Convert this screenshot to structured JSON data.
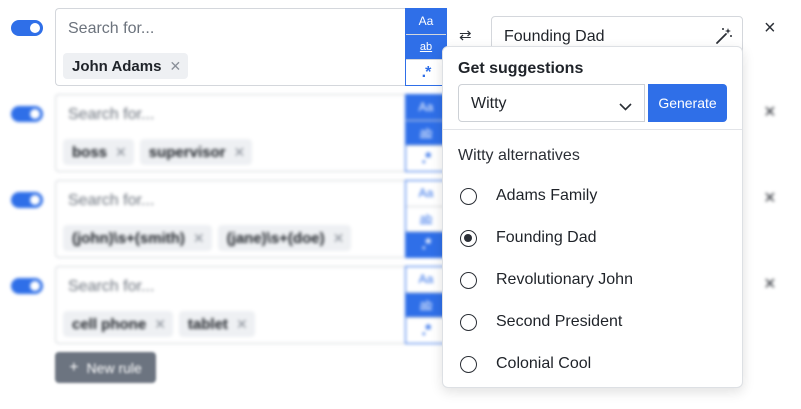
{
  "rules": [
    {
      "enabled": true,
      "placeholder": "Search for...",
      "terms": [
        "John Adams"
      ],
      "match_case": false,
      "whole_word": false,
      "regex": false
    },
    {
      "enabled": true,
      "placeholder": "Search for...",
      "terms": [
        "boss",
        "supervisor"
      ],
      "match_case": true,
      "whole_word": true,
      "regex": false
    },
    {
      "enabled": true,
      "placeholder": "Search for...",
      "terms": [
        "(john)\\s+(smith)",
        "(jane)\\s+(doe)"
      ],
      "match_case": false,
      "whole_word": false,
      "regex": true
    },
    {
      "enabled": true,
      "placeholder": "Search for...",
      "terms": [
        "cell phone",
        "tablet"
      ],
      "match_case": false,
      "whole_word": true,
      "regex": false
    }
  ],
  "option_icons": {
    "match_case": "Aa",
    "whole_word": "ab",
    "regex": ".*"
  },
  "replace": {
    "value": "Founding Dad"
  },
  "suggestions": {
    "title": "Get suggestions",
    "style": "Witty",
    "generate_label": "Generate",
    "heading": "Witty alternatives",
    "items": [
      "Adams Family",
      "Founding Dad",
      "Revolutionary John",
      "Second President",
      "Colonial Cool"
    ],
    "selected": "Founding Dad"
  },
  "new_rule_label": "New rule",
  "colors": {
    "accent": "#2f6fe8",
    "chip_bg": "#eef0f3",
    "new_rule_bg": "#6c7480"
  }
}
